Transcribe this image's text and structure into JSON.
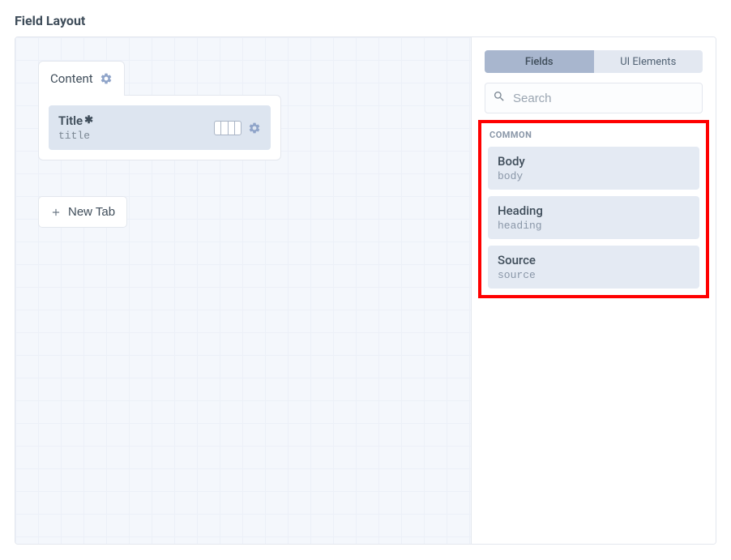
{
  "heading": "Field Layout",
  "tab": {
    "name": "Content",
    "fields": [
      {
        "label": "Title",
        "required": true,
        "handle": "title"
      }
    ]
  },
  "newTabLabel": "New Tab",
  "sidebar": {
    "tabs": {
      "fields": "Fields",
      "uiElements": "UI Elements"
    },
    "searchPlaceholder": "Search",
    "groupLabel": "COMMON",
    "available": [
      {
        "name": "Body",
        "handle": "body"
      },
      {
        "name": "Heading",
        "handle": "heading"
      },
      {
        "name": "Source",
        "handle": "source"
      }
    ]
  }
}
